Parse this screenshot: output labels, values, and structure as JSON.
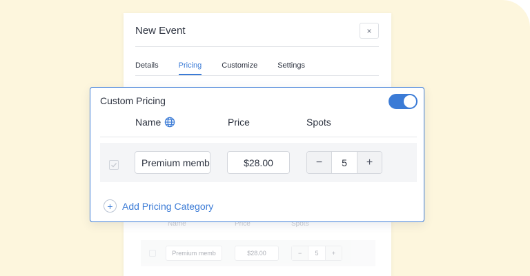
{
  "modal": {
    "title": "New Event",
    "close_glyph": "×",
    "tabs": [
      {
        "label": "Details",
        "active": false
      },
      {
        "label": "Pricing",
        "active": true
      },
      {
        "label": "Customize",
        "active": false
      },
      {
        "label": "Settings",
        "active": false
      }
    ]
  },
  "card": {
    "title": "Custom Pricing",
    "toggle_on": true,
    "columns": {
      "name": "Name",
      "price": "Price",
      "spots": "Spots"
    },
    "row": {
      "name_value": "Premium memb",
      "price_value": "$28.00",
      "spots_value": "5",
      "minus": "−",
      "plus": "+"
    },
    "add_label": "Add Pricing Category",
    "add_icon": "+"
  },
  "ghost": {
    "columns": {
      "name": "Name",
      "price": "Price",
      "spots": "Spots"
    },
    "row": {
      "name_value": "Premium memb",
      "price_value": "$28.00",
      "spots_value": "5",
      "minus": "−",
      "plus": "+"
    }
  },
  "colors": {
    "accent": "#3b7bd6",
    "background": "#fdf6dd"
  }
}
